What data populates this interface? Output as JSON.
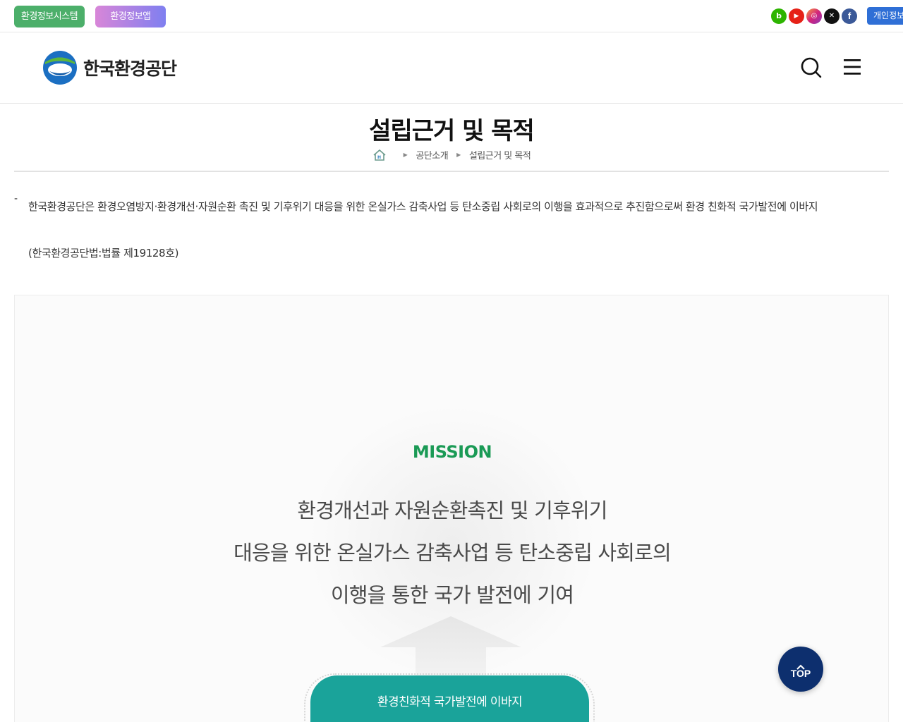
{
  "utility_bar": {
    "env_info_system": "환경정보시스템",
    "env_info_app": "환경정보앱",
    "privacy": "개인정보",
    "sns": [
      {
        "name": "blog-icon",
        "glyph": "b"
      },
      {
        "name": "youtube-icon",
        "glyph": "▶"
      },
      {
        "name": "instagram-icon",
        "glyph": "◎"
      },
      {
        "name": "x-icon",
        "glyph": "✕"
      },
      {
        "name": "facebook-icon",
        "glyph": "f"
      }
    ]
  },
  "header": {
    "logo_text": "한국환경공단"
  },
  "page": {
    "title": "설립근거 및 목적",
    "breadcrumb": [
      "공단소개",
      "설립근거 및 목적"
    ]
  },
  "description": {
    "dash": "-",
    "text": "한국환경공단은 환경오염방지·환경개선·자원순환 촉진 및 기후위기 대응을 위한 온실가스 감축사업 등 탄소중립 사회로의 이행을 효과적으로 추진함으로써 환경 친화적 국가발전에 이바지",
    "law": "(한국환경공단법:법률 제19128호)"
  },
  "mission": {
    "label": "MISSION",
    "lines": [
      "환경개선과 자원순환촉진 및 기후위기",
      "대응을 위한 온실가스 감축사업 등 탄소중립 사회로의",
      "이행을 통한 국가 발전에 기여"
    ],
    "vision_button": "환경친화적 국가발전에 이바지"
  },
  "top_button": {
    "label": "TOP"
  },
  "colors": {
    "mission_green": "#1a9a55",
    "vision_teal": "#1aa39a",
    "top_navy": "#0d2f6e",
    "system_green": "#4caf6a",
    "privacy_blue": "#2f6fd6"
  }
}
